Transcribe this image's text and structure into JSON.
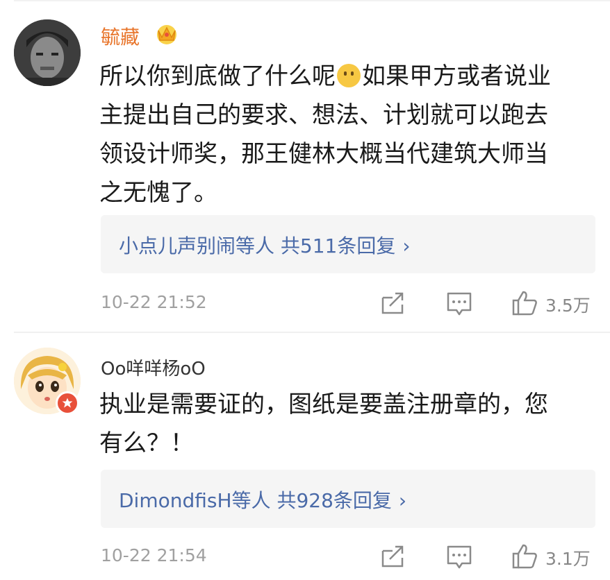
{
  "comments": [
    {
      "username": "毓藏",
      "text_lines": [
        "所以你到底做了什么呢",
        "如果甲方或者说业",
        "主提出自己的要求、想法、计划就可以跑去",
        "领设计师奖，那王健林大概当代建筑大师当",
        "之无愧了。"
      ],
      "replies_summary": "小点儿声别闹等人  共511条回复",
      "replies_chevron": "›",
      "timestamp": "10-22 21:52",
      "likes": "3.5万",
      "icons": [
        "share-icon",
        "comment-icon",
        "like-icon"
      ]
    },
    {
      "username": "Oo咩咩杨oO",
      "text_lines": [
        "执业是需要证的，图纸是要盖注册章的，您",
        "有么？！"
      ],
      "replies_summary": "DimondfisH等人  共928条回复",
      "replies_chevron": "›",
      "timestamp": "10-22 21:54",
      "likes": "3.1万",
      "icons": [
        "share-icon",
        "comment-icon",
        "like-icon"
      ]
    }
  ],
  "colors": {
    "username_vip": "#e8752b",
    "link_blue": "#4a6aa8",
    "meta_gray": "#a0a0a0"
  }
}
